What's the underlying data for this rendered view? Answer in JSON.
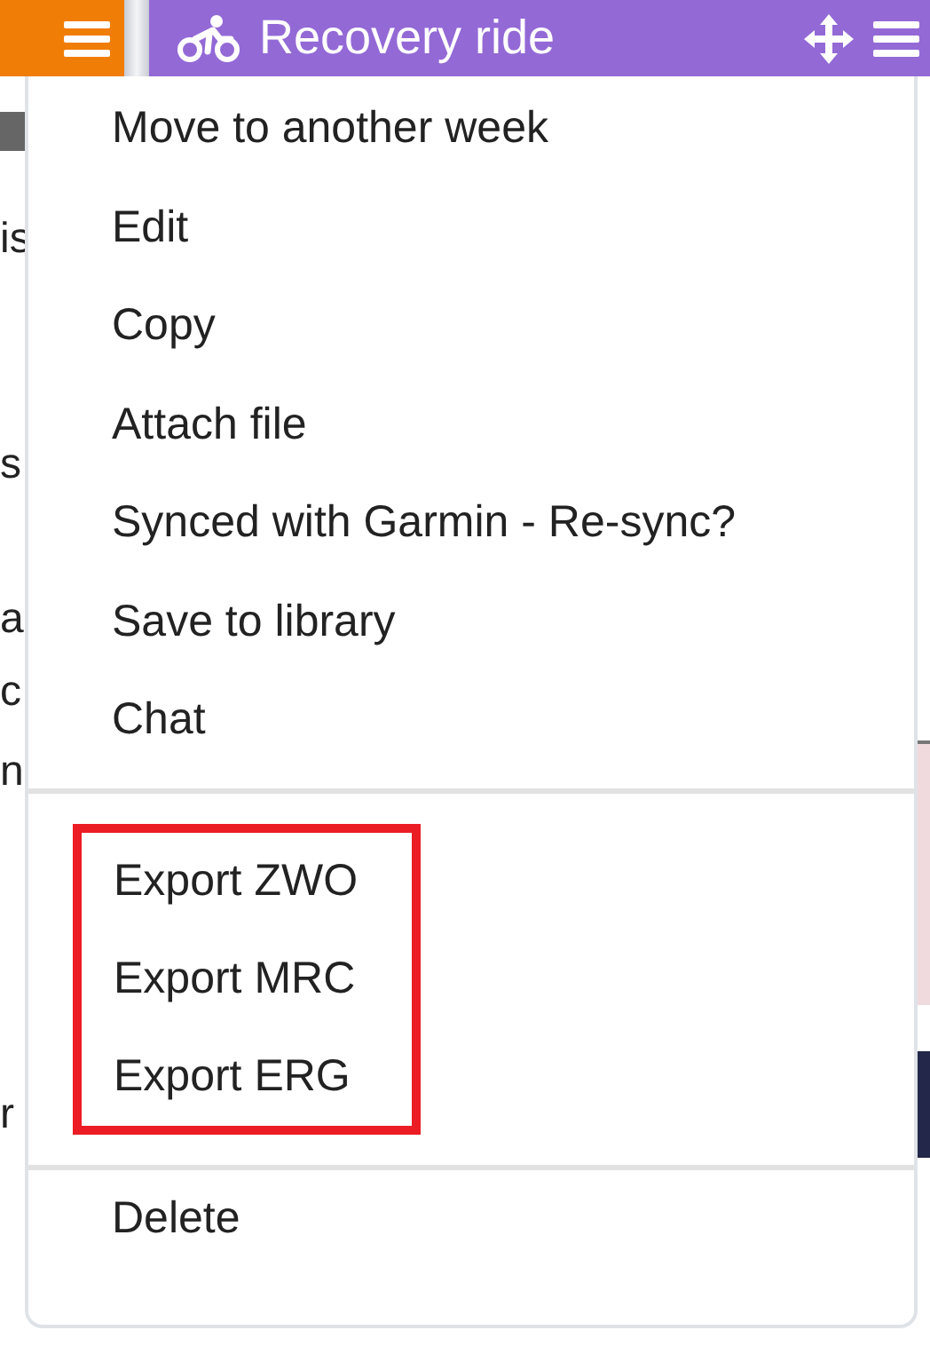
{
  "header": {
    "title": "Recovery ride"
  },
  "background_fragments": [
    "is",
    "s",
    "a",
    "c",
    "n",
    "r"
  ],
  "menu": {
    "groups": [
      {
        "framed": false,
        "items": [
          {
            "label": "Move to another week"
          },
          {
            "label": "Edit"
          },
          {
            "label": "Copy"
          },
          {
            "label": "Attach file"
          },
          {
            "label": "Synced with Garmin - Re-sync?"
          },
          {
            "label": "Save to library"
          },
          {
            "label": "Chat"
          }
        ]
      },
      {
        "framed": true,
        "items": [
          {
            "label": "Export ZWO"
          },
          {
            "label": "Export MRC"
          },
          {
            "label": "Export ERG"
          }
        ]
      },
      {
        "framed": false,
        "items": [
          {
            "label": "Delete"
          }
        ]
      }
    ]
  }
}
